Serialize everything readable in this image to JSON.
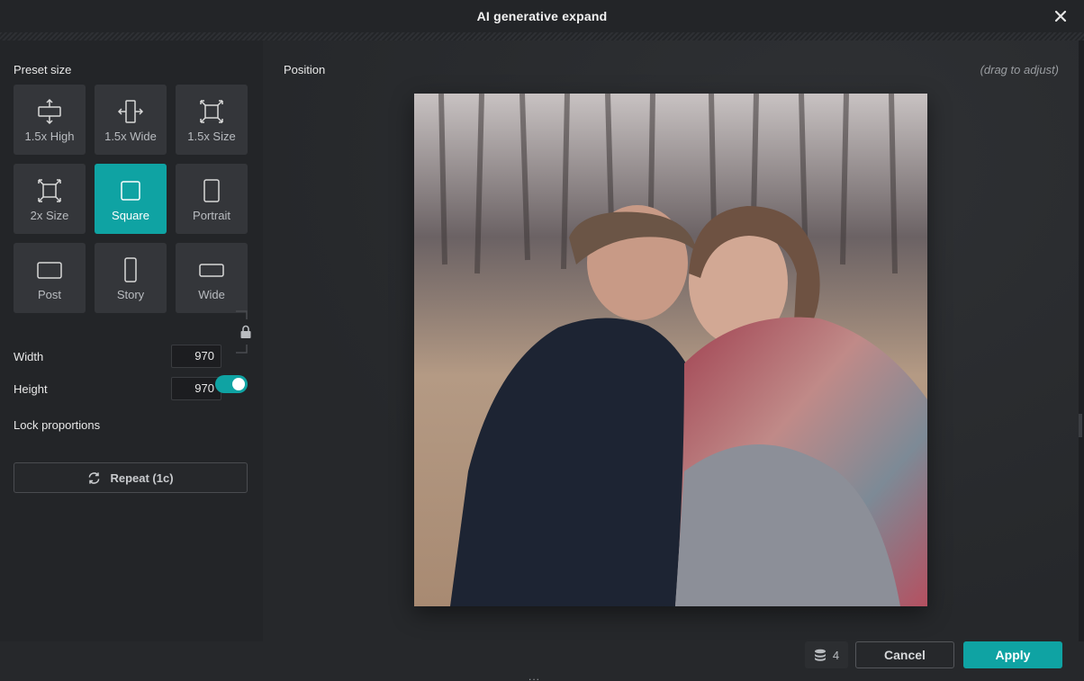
{
  "dialog": {
    "title": "AI generative expand",
    "close_icon": "close-icon"
  },
  "sidebar": {
    "preset_label": "Preset size",
    "presets": [
      {
        "label": "1.5x High",
        "icon": "expand-vertical-icon",
        "active": false
      },
      {
        "label": "1.5x Wide",
        "icon": "expand-horizontal-icon",
        "active": false
      },
      {
        "label": "1.5x Size",
        "icon": "expand-all-icon",
        "active": false
      },
      {
        "label": "2x Size",
        "icon": "expand-all-icon",
        "active": false
      },
      {
        "label": "Square",
        "icon": "square-icon",
        "active": true
      },
      {
        "label": "Portrait",
        "icon": "portrait-icon",
        "active": false
      },
      {
        "label": "Post",
        "icon": "post-icon",
        "active": false
      },
      {
        "label": "Story",
        "icon": "story-icon",
        "active": false
      },
      {
        "label": "Wide",
        "icon": "wide-icon",
        "active": false
      }
    ],
    "width_label": "Width",
    "width_value": "970",
    "height_label": "Height",
    "height_value": "970",
    "lock_label": "Lock proportions",
    "lock_on": true,
    "repeat_label": "Repeat (1c)"
  },
  "main": {
    "position_label": "Position",
    "drag_hint": "(drag to adjust)"
  },
  "footer": {
    "credits": "4",
    "cancel_label": "Cancel",
    "apply_label": "Apply",
    "grip": "..."
  },
  "colors": {
    "accent": "#0fa3a3",
    "background": "#26282b",
    "panel": "#232528",
    "tile": "#34363a"
  }
}
